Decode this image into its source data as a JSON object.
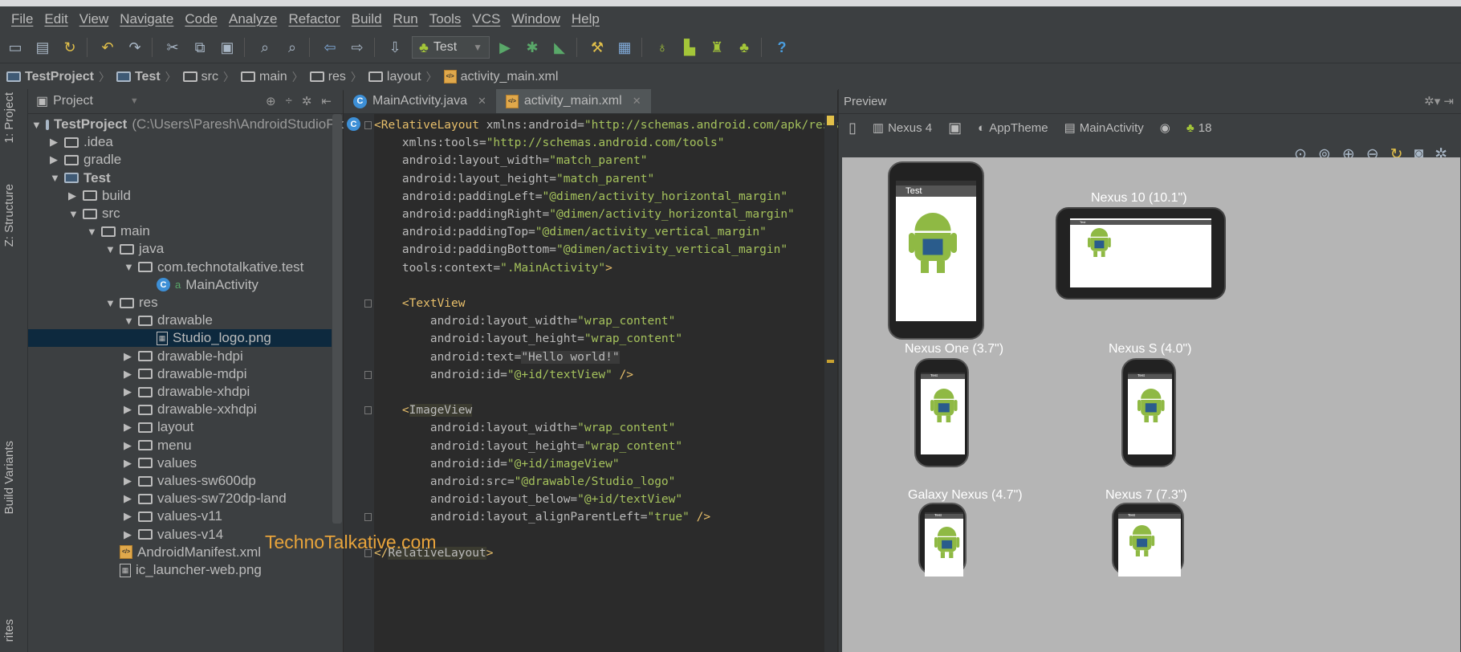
{
  "menu": [
    "File",
    "Edit",
    "View",
    "Navigate",
    "Code",
    "Analyze",
    "Refactor",
    "Build",
    "Run",
    "Tools",
    "VCS",
    "Window",
    "Help"
  ],
  "toolbar": {
    "run_config": "Test"
  },
  "breadcrumb": [
    {
      "label": "TestProject",
      "bold": true,
      "icon": "project-folder-icon"
    },
    {
      "label": "Test",
      "bold": true,
      "icon": "module-folder-icon"
    },
    {
      "label": "src",
      "icon": "folder-icon"
    },
    {
      "label": "main",
      "icon": "folder-icon"
    },
    {
      "label": "res",
      "icon": "folder-icon"
    },
    {
      "label": "layout",
      "icon": "folder-icon"
    },
    {
      "label": "activity_main.xml",
      "icon": "xml-file-icon"
    }
  ],
  "side_tabs": {
    "project": "1: Project",
    "structure": "Z: Structure",
    "build_variants": "Build Variants",
    "favorites": "rites"
  },
  "project_panel": {
    "title": "Project"
  },
  "tree": [
    {
      "label": "TestProject",
      "path": "(C:\\Users\\Paresh\\AndroidStudioProject",
      "depth": 0,
      "arrow": "down",
      "icon": "project",
      "bold": true
    },
    {
      "label": ".idea",
      "depth": 1,
      "arrow": "right",
      "icon": "folder"
    },
    {
      "label": "gradle",
      "depth": 1,
      "arrow": "right",
      "icon": "folder"
    },
    {
      "label": "Test",
      "depth": 1,
      "arrow": "down",
      "icon": "module",
      "bold": true
    },
    {
      "label": "build",
      "depth": 2,
      "arrow": "right",
      "icon": "folder"
    },
    {
      "label": "src",
      "depth": 2,
      "arrow": "down",
      "icon": "folder"
    },
    {
      "label": "main",
      "depth": 3,
      "arrow": "down",
      "icon": "folder"
    },
    {
      "label": "java",
      "depth": 4,
      "arrow": "down",
      "icon": "folder"
    },
    {
      "label": "com.technotalkative.test",
      "depth": 5,
      "arrow": "down",
      "icon": "package"
    },
    {
      "label": "MainActivity",
      "depth": 6,
      "arrow": "",
      "icon": "class"
    },
    {
      "label": "res",
      "depth": 4,
      "arrow": "down",
      "icon": "folder"
    },
    {
      "label": "drawable",
      "depth": 5,
      "arrow": "down",
      "icon": "resfolder"
    },
    {
      "label": "Studio_logo.png",
      "depth": 6,
      "arrow": "",
      "icon": "png",
      "selected": true
    },
    {
      "label": "drawable-hdpi",
      "depth": 5,
      "arrow": "right",
      "icon": "resfolder"
    },
    {
      "label": "drawable-mdpi",
      "depth": 5,
      "arrow": "right",
      "icon": "resfolder"
    },
    {
      "label": "drawable-xhdpi",
      "depth": 5,
      "arrow": "right",
      "icon": "resfolder"
    },
    {
      "label": "drawable-xxhdpi",
      "depth": 5,
      "arrow": "right",
      "icon": "resfolder"
    },
    {
      "label": "layout",
      "depth": 5,
      "arrow": "right",
      "icon": "resfolder"
    },
    {
      "label": "menu",
      "depth": 5,
      "arrow": "right",
      "icon": "resfolder"
    },
    {
      "label": "values",
      "depth": 5,
      "arrow": "right",
      "icon": "resfolder"
    },
    {
      "label": "values-sw600dp",
      "depth": 5,
      "arrow": "right",
      "icon": "resfolder"
    },
    {
      "label": "values-sw720dp-land",
      "depth": 5,
      "arrow": "right",
      "icon": "resfolder"
    },
    {
      "label": "values-v11",
      "depth": 5,
      "arrow": "right",
      "icon": "resfolder"
    },
    {
      "label": "values-v14",
      "depth": 5,
      "arrow": "right",
      "icon": "resfolder"
    },
    {
      "label": "AndroidManifest.xml",
      "depth": 4,
      "arrow": "",
      "icon": "xml"
    },
    {
      "label": "ic_launcher-web.png",
      "depth": 4,
      "arrow": "",
      "icon": "png"
    }
  ],
  "editor_tabs": [
    {
      "label": "MainActivity.java",
      "icon": "class-icon",
      "active": false
    },
    {
      "label": "activity_main.xml",
      "icon": "xml-file-icon",
      "active": true
    }
  ],
  "code_lines": [
    [
      [
        "tag",
        "<RelativeLayout "
      ],
      [
        "attr",
        "xmlns:android="
      ],
      [
        "val",
        "\"http://schemas.android.com/apk/res/an"
      ]
    ],
    [
      [
        "attr",
        "    xmlns:tools="
      ],
      [
        "val",
        "\"http://schemas.android.com/tools\""
      ]
    ],
    [
      [
        "attr",
        "    android:layout_width="
      ],
      [
        "val",
        "\"match_parent\""
      ]
    ],
    [
      [
        "attr",
        "    android:layout_height="
      ],
      [
        "val",
        "\"match_parent\""
      ]
    ],
    [
      [
        "attr",
        "    android:paddingLeft="
      ],
      [
        "val",
        "\"@dimen/activity_horizontal_margin\""
      ]
    ],
    [
      [
        "attr",
        "    android:paddingRight="
      ],
      [
        "val",
        "\"@dimen/activity_horizontal_margin\""
      ]
    ],
    [
      [
        "attr",
        "    android:paddingTop="
      ],
      [
        "val",
        "\"@dimen/activity_vertical_margin\""
      ]
    ],
    [
      [
        "attr",
        "    android:paddingBottom="
      ],
      [
        "val",
        "\"@dimen/activity_vertical_margin\""
      ]
    ],
    [
      [
        "attr",
        "    tools:context="
      ],
      [
        "val",
        "\".MainActivity\""
      ],
      [
        "tag",
        ">"
      ]
    ],
    [],
    [
      [
        "tag",
        "    <TextView"
      ]
    ],
    [
      [
        "attr",
        "        android:layout_width="
      ],
      [
        "val",
        "\"wrap_content\""
      ]
    ],
    [
      [
        "attr",
        "        android:layout_height="
      ],
      [
        "val",
        "\"wrap_content\""
      ]
    ],
    [
      [
        "attr",
        "        android:text="
      ],
      [
        "hl",
        "\"Hello world!\""
      ]
    ],
    [
      [
        "attr",
        "        android:id="
      ],
      [
        "val",
        "\"@+id/textView\""
      ],
      [
        "tag",
        " />"
      ]
    ],
    [],
    [
      [
        "tag",
        "    <"
      ],
      [
        "tagbg",
        "ImageView"
      ]
    ],
    [
      [
        "attr",
        "        android:layout_width="
      ],
      [
        "val",
        "\"wrap_content\""
      ]
    ],
    [
      [
        "attr",
        "        android:layout_height="
      ],
      [
        "val",
        "\"wrap_content\""
      ]
    ],
    [
      [
        "attr",
        "        android:id="
      ],
      [
        "val",
        "\"@+id/imageView\""
      ]
    ],
    [
      [
        "attr",
        "        android:src="
      ],
      [
        "val",
        "\"@drawable/Studio_logo\""
      ]
    ],
    [
      [
        "attr",
        "        android:layout_below="
      ],
      [
        "val",
        "\"@+id/textView\""
      ]
    ],
    [
      [
        "attr",
        "        android:layout_alignParentLeft="
      ],
      [
        "val",
        "\"true\""
      ],
      [
        "tag",
        " />"
      ]
    ],
    [],
    [
      [
        "tag",
        "</"
      ],
      [
        "tagbg",
        "RelativeLayout"
      ],
      [
        "tag",
        ">"
      ]
    ]
  ],
  "preview": {
    "title": "Preview",
    "device": "Nexus 4",
    "theme": "AppTheme",
    "activity": "MainActivity",
    "api": "18",
    "app_title": "Test",
    "devices": [
      "Nexus 10 (10.1\")",
      "Nexus One (3.7\")",
      "Nexus S (4.0\")",
      "Galaxy Nexus (4.7\")",
      "Nexus 7 (7.3\")"
    ]
  },
  "watermark": "TechnoTalkative.com",
  "colors": {
    "accent_green": "#a4c639",
    "tag": "#e8bf6a",
    "string": "#a5c25c",
    "selection": "#0d293e"
  }
}
